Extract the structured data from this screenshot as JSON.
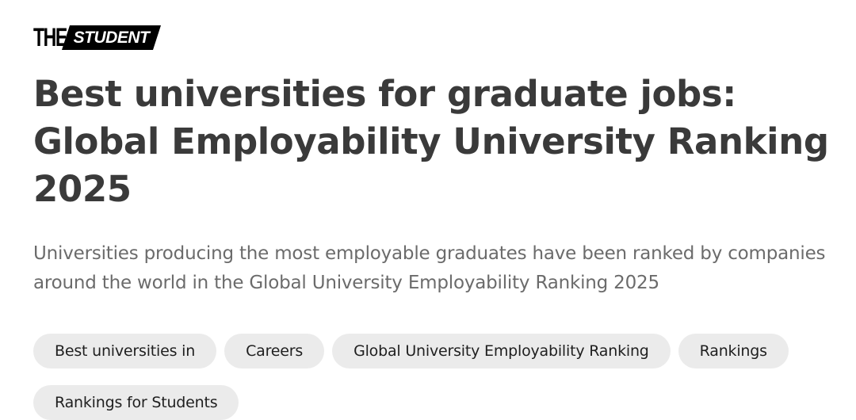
{
  "brand": {
    "prefix": "THE",
    "name": "STUDENT"
  },
  "article": {
    "title": "Best universities for graduate jobs: Global Employability University Ranking 2025",
    "subtitle": "Universities producing the most employable graduates have been ranked by companies around the world in the Global University Employability Ranking 2025"
  },
  "tags": [
    {
      "label": "Best universities in"
    },
    {
      "label": "Careers"
    },
    {
      "label": "Global University Employability Ranking"
    },
    {
      "label": "Rankings"
    },
    {
      "label": "Rankings for Students"
    }
  ],
  "colors": {
    "title": "#3a3a3a",
    "subtitle": "#6b6b6b",
    "tag_bg": "#ebebeb",
    "logo": "#000000"
  }
}
